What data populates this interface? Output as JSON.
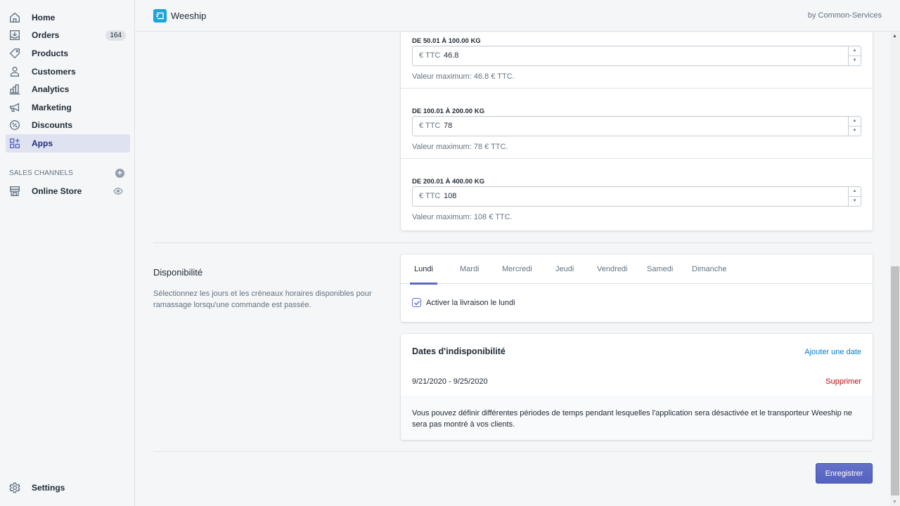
{
  "sidebar": {
    "items": [
      {
        "label": "Home",
        "icon": "home-icon"
      },
      {
        "label": "Orders",
        "icon": "orders-icon",
        "badge": "164"
      },
      {
        "label": "Products",
        "icon": "tag-icon"
      },
      {
        "label": "Customers",
        "icon": "person-icon"
      },
      {
        "label": "Analytics",
        "icon": "bar-chart-icon"
      },
      {
        "label": "Marketing",
        "icon": "megaphone-icon"
      },
      {
        "label": "Discounts",
        "icon": "discount-icon"
      },
      {
        "label": "Apps",
        "icon": "apps-icon",
        "active": true
      }
    ],
    "sales_channels_label": "SALES CHANNELS",
    "online_store_label": "Online Store",
    "settings_label": "Settings"
  },
  "header": {
    "app_name": "Weeship",
    "by_line": "by Common-Services"
  },
  "price_ranges": [
    {
      "label": "DE 50.01 À 100.00 KG",
      "prefix": "€ TTC",
      "value": "46.8",
      "help": "Valeur maximum: 46.8 € TTC."
    },
    {
      "label": "DE 100.01 À 200.00 KG",
      "prefix": "€ TTC",
      "value": "78",
      "help": "Valeur maximum: 78 € TTC."
    },
    {
      "label": "DE 200.01 À 400.00 KG",
      "prefix": "€ TTC",
      "value": "108",
      "help": "Valeur maximum: 108 € TTC."
    }
  ],
  "availability": {
    "title": "Disponibilité",
    "description": "Sélectionnez les jours et les créneaux horaires disponibles pour ramassage lorsqu'une commande est passée.",
    "tabs": [
      "Lundi",
      "Mardi",
      "Mercredi",
      "Jeudi",
      "Vendredi",
      "Samedi",
      "Dimanche"
    ],
    "active_tab": "Lundi",
    "checkbox_label": "Activer la livraison le lundi",
    "checkbox_checked": true
  },
  "unavailability": {
    "title": "Dates d'indisponibilité",
    "add_label": "Ajouter une date",
    "dates": [
      {
        "range": "9/21/2020 - 9/25/2020",
        "delete_label": "Supprimer"
      }
    ],
    "footer": "Vous pouvez définir différentes périodes de temps pendant lesquelles l'application sera désactivée et le transporteur Weeship ne sera pas montré à vos clients."
  },
  "save_label": "Enregistrer",
  "colors": {
    "accent": "#5c6ac4",
    "link": "#007ace",
    "destructive": "#bf0711",
    "app_logo": "#1ba3dc"
  }
}
